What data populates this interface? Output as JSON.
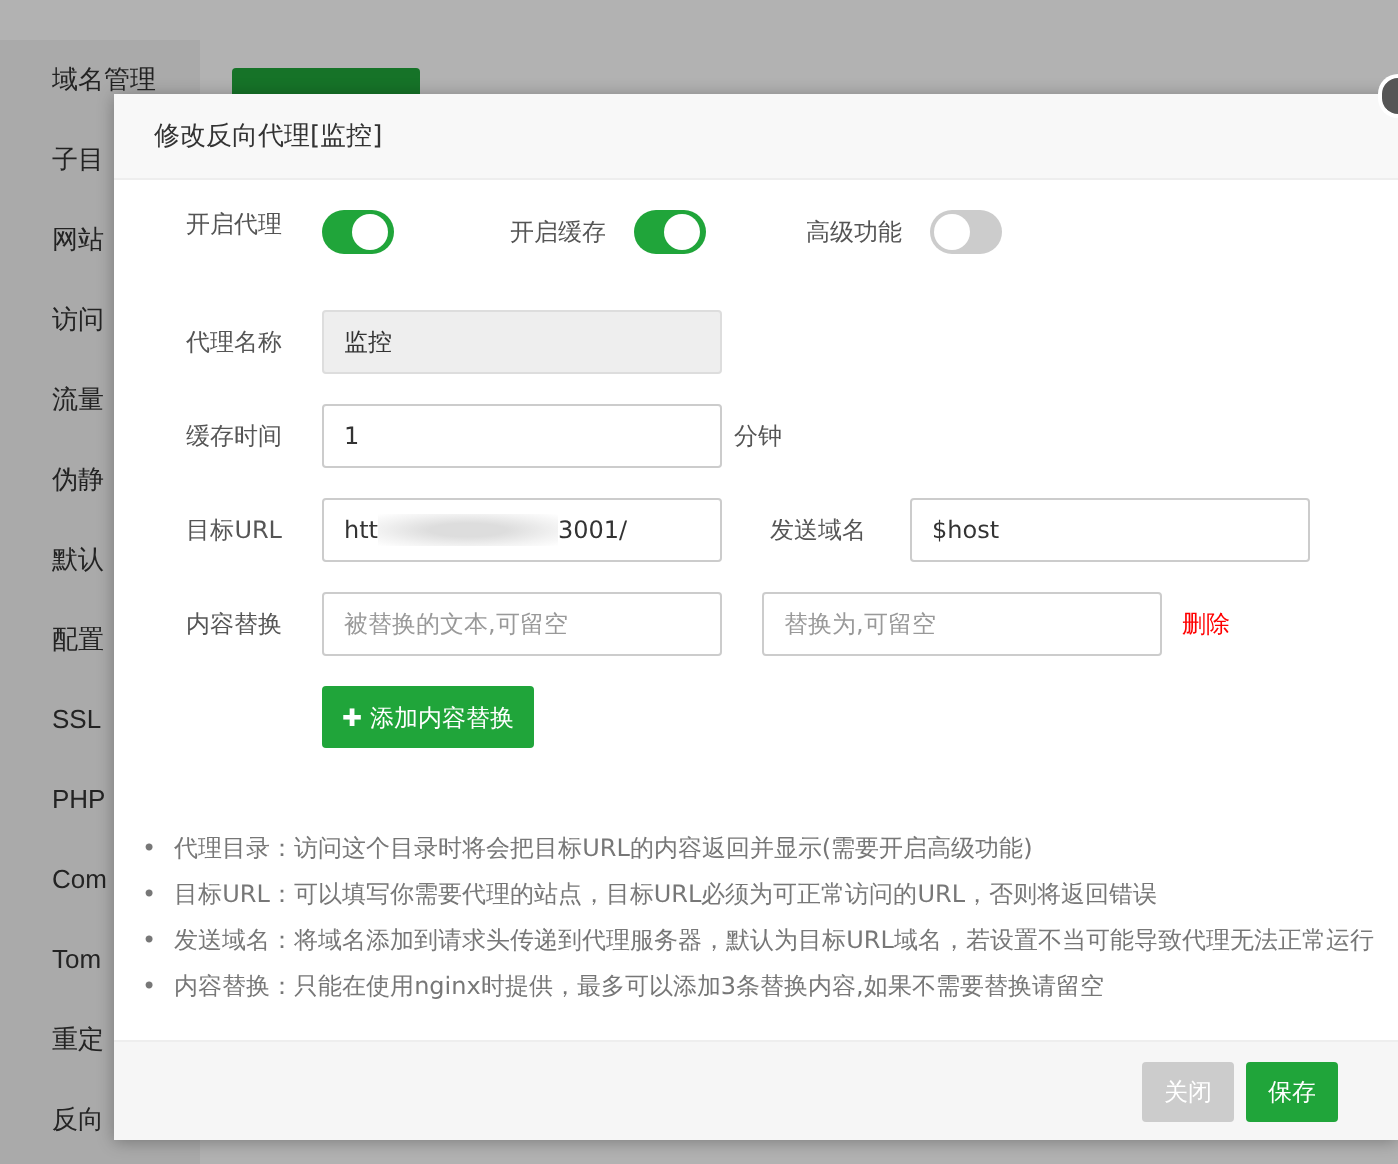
{
  "sidebar": {
    "items": [
      {
        "label": "域名管理"
      },
      {
        "label": "子目"
      },
      {
        "label": "网站"
      },
      {
        "label": "访问"
      },
      {
        "label": "流量"
      },
      {
        "label": "伪静"
      },
      {
        "label": "默认"
      },
      {
        "label": "配置"
      },
      {
        "label": "SSL"
      },
      {
        "label": "PHP"
      },
      {
        "label": "Com"
      },
      {
        "label": "Tom"
      },
      {
        "label": "重定"
      },
      {
        "label": "反向"
      }
    ]
  },
  "dialog": {
    "title": "修改反向代理[监控]",
    "switches": [
      {
        "label": "开启代理",
        "on": true
      },
      {
        "label": "开启缓存",
        "on": true
      },
      {
        "label": "高级功能",
        "on": false
      }
    ],
    "name_field": {
      "label": "代理名称",
      "value": "监控",
      "disabled": true
    },
    "cache_field": {
      "label": "缓存时间",
      "value": "1",
      "unit": "分钟"
    },
    "url_field": {
      "label": "目标URL",
      "value_start": "htt",
      "value_end": "3001/"
    },
    "host_field": {
      "label": "发送域名",
      "value": "$host"
    },
    "replace": {
      "label": "内容替换",
      "from_placeholder": "被替换的文本,可留空",
      "to_placeholder": "替换为,可留空",
      "delete": "删除"
    },
    "add_button": {
      "icon": "✚",
      "label": "添加内容替换"
    },
    "tip_marker": "•",
    "tips": [
      "代理目录：访问这个目录时将会把目标URL的内容返回并显示(需要开启高级功能)",
      "目标URL：可以填写你需要代理的站点，目标URL必须为可正常访问的URL，否则将返回错误",
      "发送域名：将域名添加到请求头传递到代理服务器，默认为目标URL域名，若设置不当可能导致代理无法正常运行",
      "内容替换：只能在使用nginx时提供，最多可以添加3条替换内容,如果不需要替换请留空"
    ],
    "buttons": [
      {
        "label": "关闭",
        "kind": "secondary"
      },
      {
        "label": "保存",
        "kind": "primary"
      }
    ]
  }
}
